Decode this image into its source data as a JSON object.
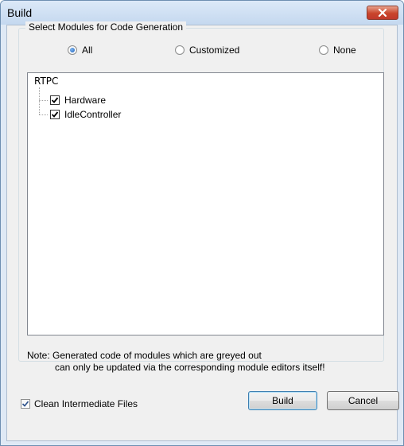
{
  "window": {
    "title": "Build"
  },
  "group": {
    "label": "Select Modules for Code Generation",
    "radios": [
      {
        "label": "All",
        "selected": true
      },
      {
        "label": "Customized",
        "selected": false
      },
      {
        "label": "None",
        "selected": false
      }
    ]
  },
  "tree": {
    "root": "RTPC",
    "items": [
      {
        "label": "Hardware",
        "checked": true
      },
      {
        "label": "IdleController",
        "checked": true
      }
    ]
  },
  "note": {
    "line1": "Note: Generated code of modules which are greyed out",
    "line2": "can only be updated via the corresponding module editors itself!"
  },
  "options": {
    "clean_label": "Clean Intermediate Files",
    "clean_checked": true
  },
  "buttons": {
    "build": "Build",
    "cancel": "Cancel"
  },
  "colors": {
    "titlebar": "#c4d8ef",
    "close_button": "#c9452b",
    "client": "#f0f0f0",
    "accent": "#1d5fb8"
  }
}
